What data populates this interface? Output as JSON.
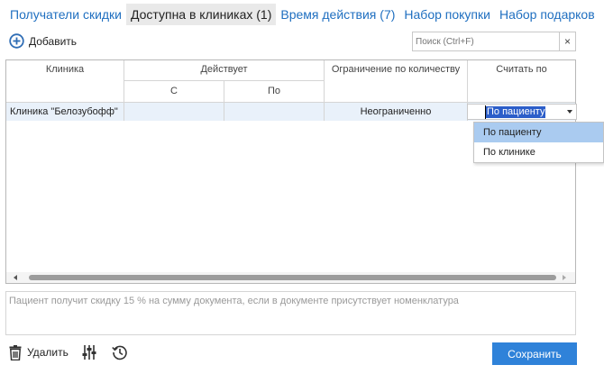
{
  "tabs": [
    {
      "label": "Получатели скидки",
      "active": false
    },
    {
      "label": "Доступна в клиниках (1)",
      "active": true
    },
    {
      "label": "Время действия (7)",
      "active": false
    },
    {
      "label": "Набор покупки",
      "active": false
    },
    {
      "label": "Набор подарков",
      "active": false
    }
  ],
  "toolbar": {
    "add_label": "Добавить"
  },
  "search": {
    "placeholder": "Поиск (Ctrl+F)",
    "clear_label": "×"
  },
  "grid": {
    "headers": {
      "clinic": "Клиника",
      "valid": "Действует",
      "from": "С",
      "to": "По",
      "limit": "Ограничение по количеству",
      "count_by": "Считать по"
    },
    "rows": [
      {
        "clinic": "Клиника \"Белозубофф\"",
        "from": "",
        "to": "",
        "limit": "Неограниченно",
        "count_by": "По пациенту"
      }
    ]
  },
  "dropdown": {
    "options": [
      "По пациенту",
      "По клинике"
    ],
    "selected": "По пациенту"
  },
  "description": "Пациент получит скидку 15 % на сумму документа, если в документе присутствует номенклатура",
  "footer": {
    "delete_label": "Удалить",
    "save_label": "Сохранить"
  },
  "colors": {
    "accent": "#2f82d9",
    "tab_link": "#1f6fc0",
    "selection": "#2c5ec9",
    "row_highlight": "#e9f1fa"
  }
}
